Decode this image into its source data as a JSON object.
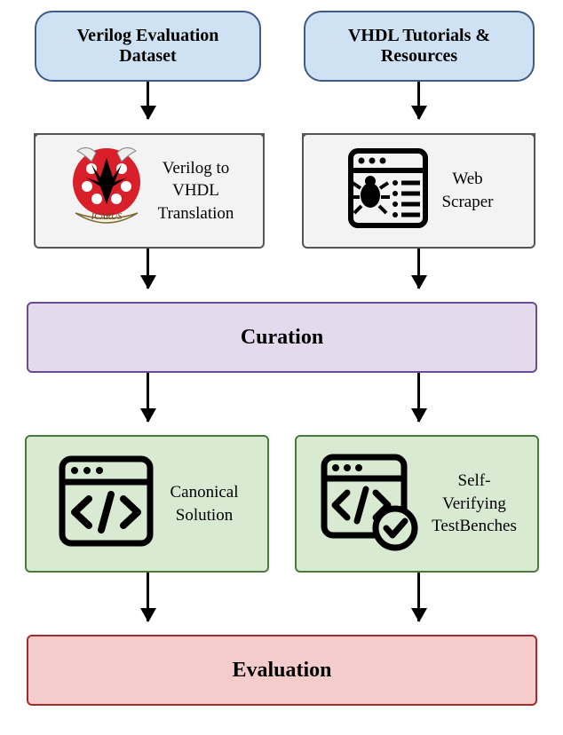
{
  "input_left": {
    "title": "Verilog Evaluation\nDataset"
  },
  "input_right": {
    "title": "VHDL Tutorials &\nResources"
  },
  "process_left": {
    "label": "Verilog to\nVHDL\nTranslation",
    "logo_name": "icarus-logo"
  },
  "process_right": {
    "label": "Web\nScraper"
  },
  "curation": {
    "title": "Curation"
  },
  "output_left": {
    "label": "Canonical\nSolution"
  },
  "output_right": {
    "label": "Self-\nVerifying\nTestBenches"
  },
  "evaluation": {
    "title": "Evaluation"
  },
  "chart_data": {
    "type": "flowchart",
    "nodes": [
      {
        "id": "verilog_dataset",
        "label": "Verilog Evaluation Dataset",
        "kind": "input"
      },
      {
        "id": "vhdl_tutorials",
        "label": "VHDL Tutorials & Resources",
        "kind": "input"
      },
      {
        "id": "translation",
        "label": "Verilog to VHDL Translation",
        "kind": "process",
        "tool": "Icarus"
      },
      {
        "id": "scraper",
        "label": "Web Scraper",
        "kind": "process"
      },
      {
        "id": "curation",
        "label": "Curation",
        "kind": "aggregate"
      },
      {
        "id": "canonical",
        "label": "Canonical Solution",
        "kind": "output"
      },
      {
        "id": "testbenches",
        "label": "Self-Verifying TestBenches",
        "kind": "output"
      },
      {
        "id": "evaluation",
        "label": "Evaluation",
        "kind": "final"
      }
    ],
    "edges": [
      [
        "verilog_dataset",
        "translation"
      ],
      [
        "vhdl_tutorials",
        "scraper"
      ],
      [
        "translation",
        "curation"
      ],
      [
        "scraper",
        "curation"
      ],
      [
        "curation",
        "canonical"
      ],
      [
        "curation",
        "testbenches"
      ],
      [
        "canonical",
        "evaluation"
      ],
      [
        "testbenches",
        "evaluation"
      ]
    ]
  }
}
